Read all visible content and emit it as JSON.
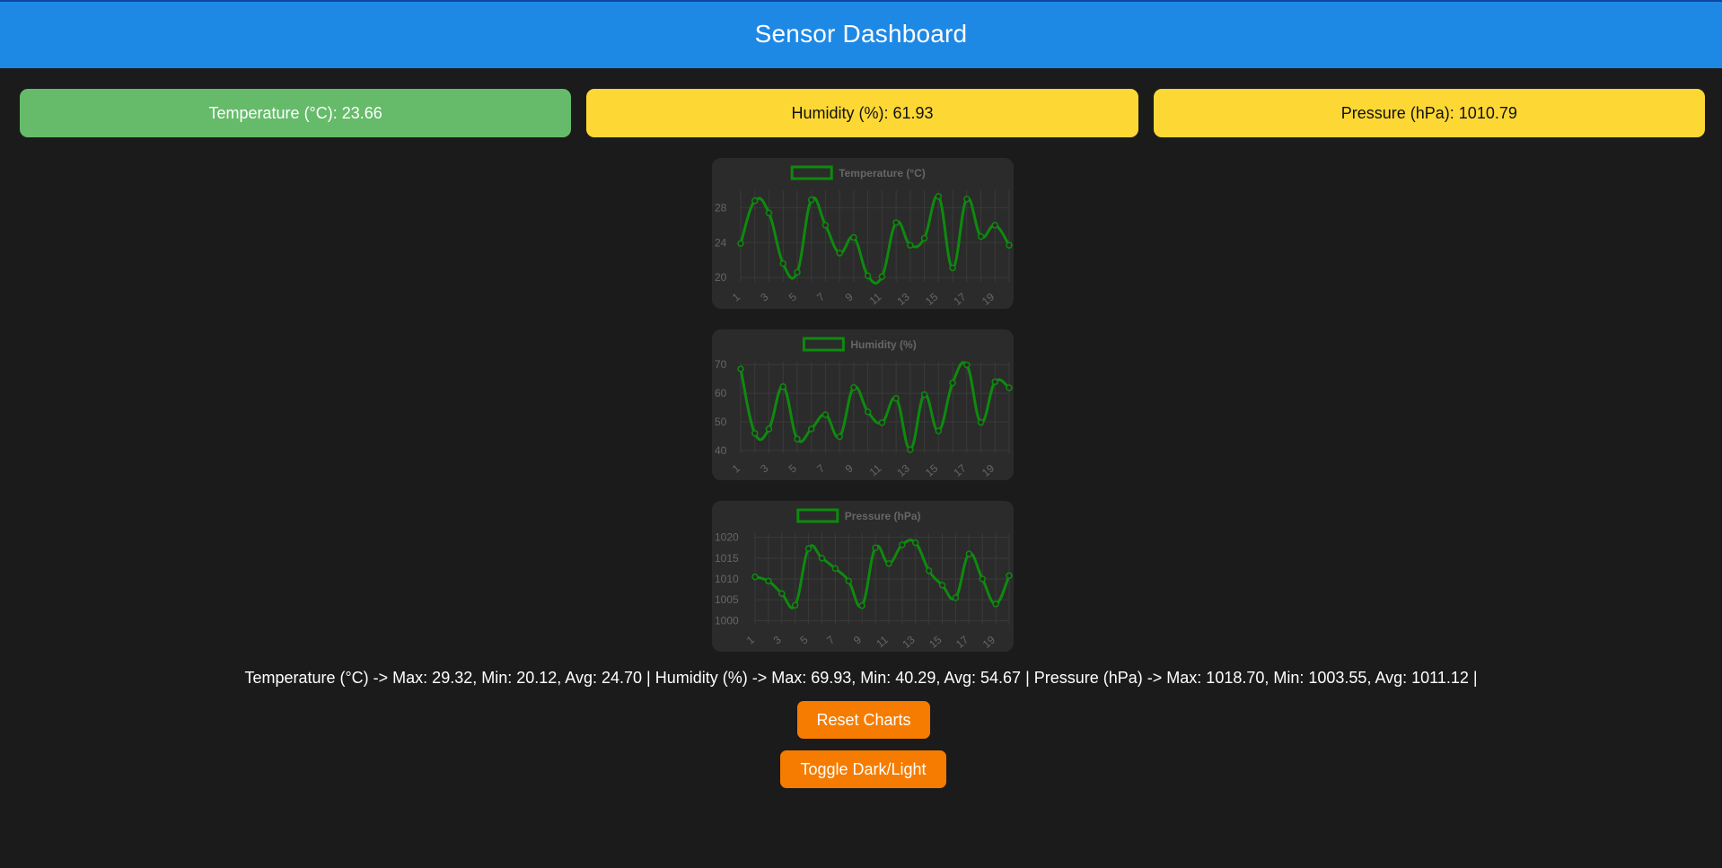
{
  "header": {
    "title": "Sensor Dashboard"
  },
  "cards": [
    {
      "text": "Temperature (°C): 23.66",
      "bg": "#66bb6a",
      "fg": "#ffffff"
    },
    {
      "text": "Humidity (%): 61.93",
      "bg": "#fdd835",
      "fg": "#111111"
    },
    {
      "text": "Pressure (hPa): 1010.79",
      "bg": "#fdd835",
      "fg": "#111111"
    }
  ],
  "colors": {
    "header": "#1e88e5",
    "background": "#1b1b1b",
    "chart_panel": "#2b2b2b",
    "series": "#0e8a0e",
    "button": "#f57c00"
  },
  "chart_data": [
    {
      "type": "line",
      "legend": "Temperature (°C)",
      "x": [
        1,
        2,
        3,
        4,
        5,
        6,
        7,
        8,
        9,
        10,
        11,
        12,
        13,
        14,
        15,
        16,
        17,
        18,
        19,
        20
      ],
      "x_tick_labels": [
        "1",
        "3",
        "5",
        "7",
        "9",
        "11",
        "13",
        "15",
        "17",
        "19"
      ],
      "y_ticks": [
        20,
        24,
        28
      ],
      "ylim": [
        19.5,
        30
      ],
      "values": [
        23.9,
        28.8,
        27.4,
        21.6,
        20.6,
        28.9,
        26.0,
        22.8,
        24.6,
        20.2,
        20.1,
        26.3,
        23.7,
        24.5,
        29.3,
        21.1,
        29.0,
        24.7,
        26.0,
        23.7
      ],
      "grid": true,
      "legend_position": "top-center"
    },
    {
      "type": "line",
      "legend": "Humidity (%)",
      "x": [
        1,
        2,
        3,
        4,
        5,
        6,
        7,
        8,
        9,
        10,
        11,
        12,
        13,
        14,
        15,
        16,
        17,
        18,
        19,
        20
      ],
      "x_tick_labels": [
        "1",
        "3",
        "5",
        "7",
        "9",
        "11",
        "13",
        "15",
        "17",
        "19"
      ],
      "y_ticks": [
        40,
        50,
        60,
        70
      ],
      "ylim": [
        39,
        71
      ],
      "values": [
        68.5,
        46.0,
        47.5,
        62.3,
        44.0,
        47.5,
        52.5,
        44.8,
        62.0,
        53.5,
        49.7,
        58.2,
        40.3,
        59.5,
        46.8,
        63.6,
        69.9,
        49.8,
        64.0,
        61.9
      ],
      "grid": true,
      "legend_position": "top-center"
    },
    {
      "type": "line",
      "legend": "Pressure (hPa)",
      "x": [
        1,
        2,
        3,
        4,
        5,
        6,
        7,
        8,
        9,
        10,
        11,
        12,
        13,
        14,
        15,
        16,
        17,
        18,
        19,
        20
      ],
      "x_tick_labels": [
        "1",
        "3",
        "5",
        "7",
        "9",
        "11",
        "13",
        "15",
        "17",
        "19"
      ],
      "y_ticks": [
        1000,
        1005,
        1010,
        1015,
        1020
      ],
      "ylim": [
        999,
        1021
      ],
      "values": [
        1010.5,
        1009.5,
        1006.5,
        1003.7,
        1017.3,
        1015.0,
        1012.5,
        1009.5,
        1003.6,
        1017.5,
        1013.7,
        1018.2,
        1018.7,
        1012.0,
        1008.5,
        1005.5,
        1016.0,
        1010.0,
        1004.0,
        1010.8
      ],
      "grid": true,
      "legend_position": "top-center"
    }
  ],
  "summary": "Temperature (°C) -> Max: 29.32, Min: 20.12, Avg: 24.70 | Humidity (%) -> Max: 69.93, Min: 40.29, Avg: 54.67 | Pressure (hPa) -> Max: 1018.70, Min: 1003.55, Avg: 1011.12 |",
  "buttons": {
    "reset": "Reset Charts",
    "toggle": "Toggle Dark/Light"
  }
}
